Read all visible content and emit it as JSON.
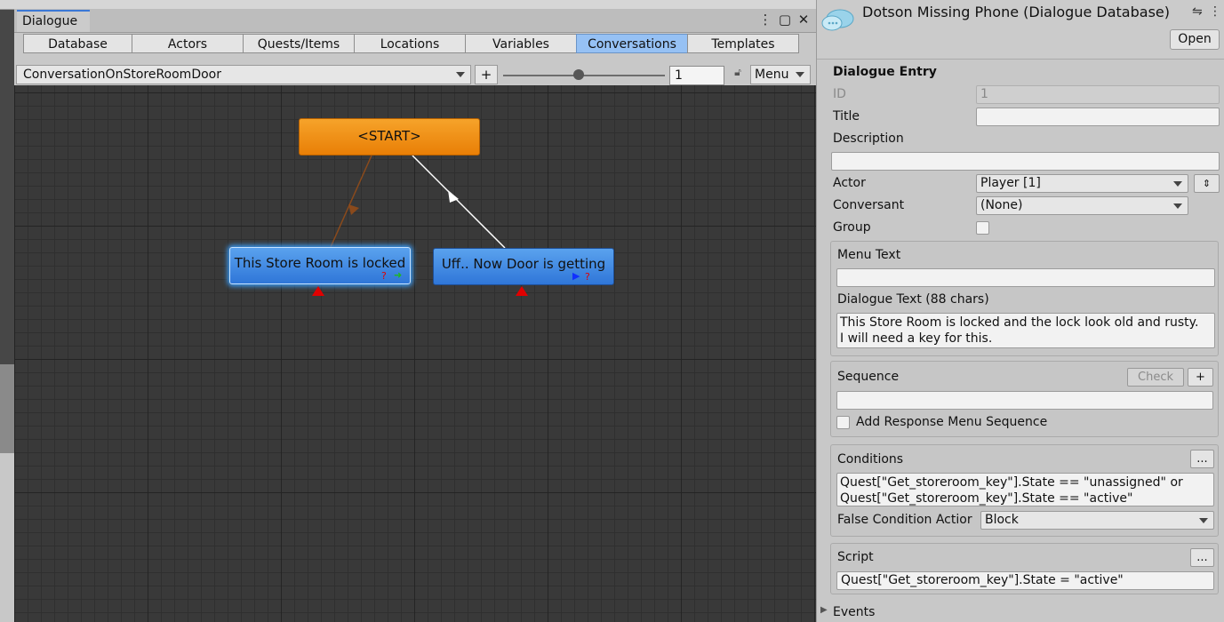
{
  "dialogue_window": {
    "tab_title": "Dialogue",
    "tabs": [
      {
        "label": "Database",
        "active": false
      },
      {
        "label": "Actors",
        "active": false
      },
      {
        "label": "Quests/Items",
        "active": false
      },
      {
        "label": "Locations",
        "active": false
      },
      {
        "label": "Variables",
        "active": false
      },
      {
        "label": "Conversations",
        "active": true
      },
      {
        "label": "Templates",
        "active": false
      }
    ],
    "conversation_select": "ConversationOnStoreRoomDoor",
    "add_label": "+",
    "zoom_value": "1",
    "menu_label": "Menu"
  },
  "graph": {
    "nodes": {
      "start": {
        "label": "<START>",
        "color": "#f08d12"
      },
      "a": {
        "label": "This Store Room is locked",
        "color": "#3f8ae6",
        "selected": true
      },
      "b": {
        "label": "Uff.. Now Door is getting",
        "color": "#3f8ae6",
        "selected": false
      }
    },
    "link_colors": {
      "to_a": "#8a4a1c",
      "to_b": "#ffffff"
    }
  },
  "inspector": {
    "db_title": "Dotson Missing Phone (Dialogue Database)",
    "open_label": "Open",
    "section_title": "Dialogue Entry",
    "id_label": "ID",
    "id_value": "1",
    "title_label": "Title",
    "title_value": "",
    "description_label": "Description",
    "description_value": "",
    "actor_label": "Actor",
    "actor_value": "Player [1]",
    "conversant_label": "Conversant",
    "conversant_value": "(None)",
    "group_label": "Group",
    "menu_text_label": "Menu Text",
    "menu_text_value": "",
    "dialogue_text_label": "Dialogue Text (88 chars)",
    "dialogue_text_lines": [
      "This Store Room is locked and the lock look old and rusty.",
      "I will need a key for this."
    ],
    "sequence_label": "Sequence",
    "check_label": "Check",
    "plus_label": "+",
    "sequence_value": "",
    "add_response_label": "Add Response Menu Sequence",
    "conditions_label": "Conditions",
    "ellipsis_label": "...",
    "conditions_lines": [
      "Quest[\"Get_storeroom_key\"].State == \"unassigned\" or",
      "Quest[\"Get_storeroom_key\"].State == \"active\""
    ],
    "false_condition_label": "False Condition Actior",
    "false_condition_value": "Block",
    "script_label": "Script",
    "script_value": "Quest[\"Get_storeroom_key\"].State = \"active\"",
    "events_label": "Events"
  }
}
